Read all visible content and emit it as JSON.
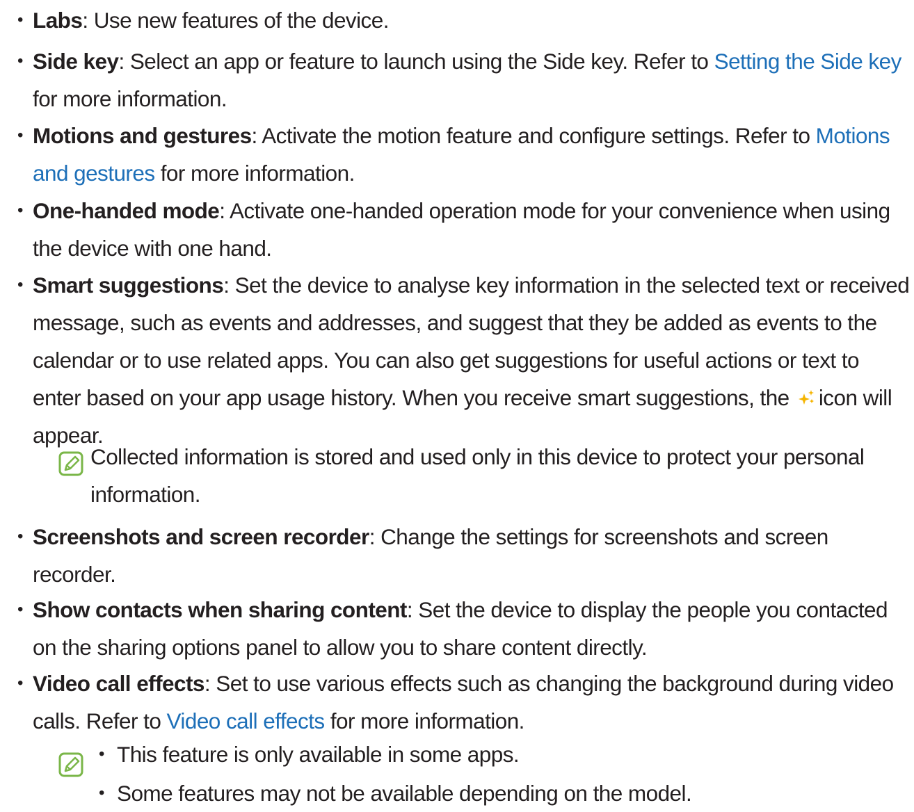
{
  "bullet_char": "•",
  "sub_bullet_char": "•",
  "colors": {
    "text": "#231f20",
    "link": "#1d6fb8",
    "note_icon": "#7ab648",
    "sparkle": "#f5b400"
  },
  "icons": {
    "note": "note-pencil-icon",
    "smart_suggestion": "sparkle-icon"
  },
  "items": [
    {
      "term": "Labs",
      "text": ": Use new features of the device."
    },
    {
      "term": "Side key",
      "text": ": Select an app or feature to launch using the Side key. Refer to ",
      "link": "Setting the Side key",
      "after": " for more information."
    },
    {
      "term": "Motions and gestures",
      "text": ": Activate the motion feature and configure settings. Refer to ",
      "link": "Motions and gestures",
      "after": " for more information."
    },
    {
      "term": "One-handed mode",
      "text": ": Activate one-handed operation mode for your convenience when using the device with one hand."
    },
    {
      "term": "Smart suggestions",
      "text": ": Set the device to analyse key information in the selected text or received message, such as events and addresses, and suggest that they be added as events to the calendar or to use related apps. You can also get suggestions for useful actions or text to enter based on your app usage history. When you receive smart suggestions, the",
      "after": "icon will appear.",
      "note": "Collected information is stored and used only in this device to protect your personal information."
    },
    {
      "term": "Screenshots and screen recorder",
      "text": ": Change the settings for screenshots and screen recorder."
    },
    {
      "term": "Show contacts when sharing content",
      "text": ": Set the device to display the people you contacted on the sharing options panel to allow you to share content directly."
    },
    {
      "term": "Video call effects",
      "text": ": Set to use various effects such as changing the background during video calls. Refer to ",
      "link": "Video call effects",
      "after": " for more information.",
      "notes": [
        "This feature is only available in some apps.",
        "Some features may not be available depending on the model."
      ]
    }
  ]
}
